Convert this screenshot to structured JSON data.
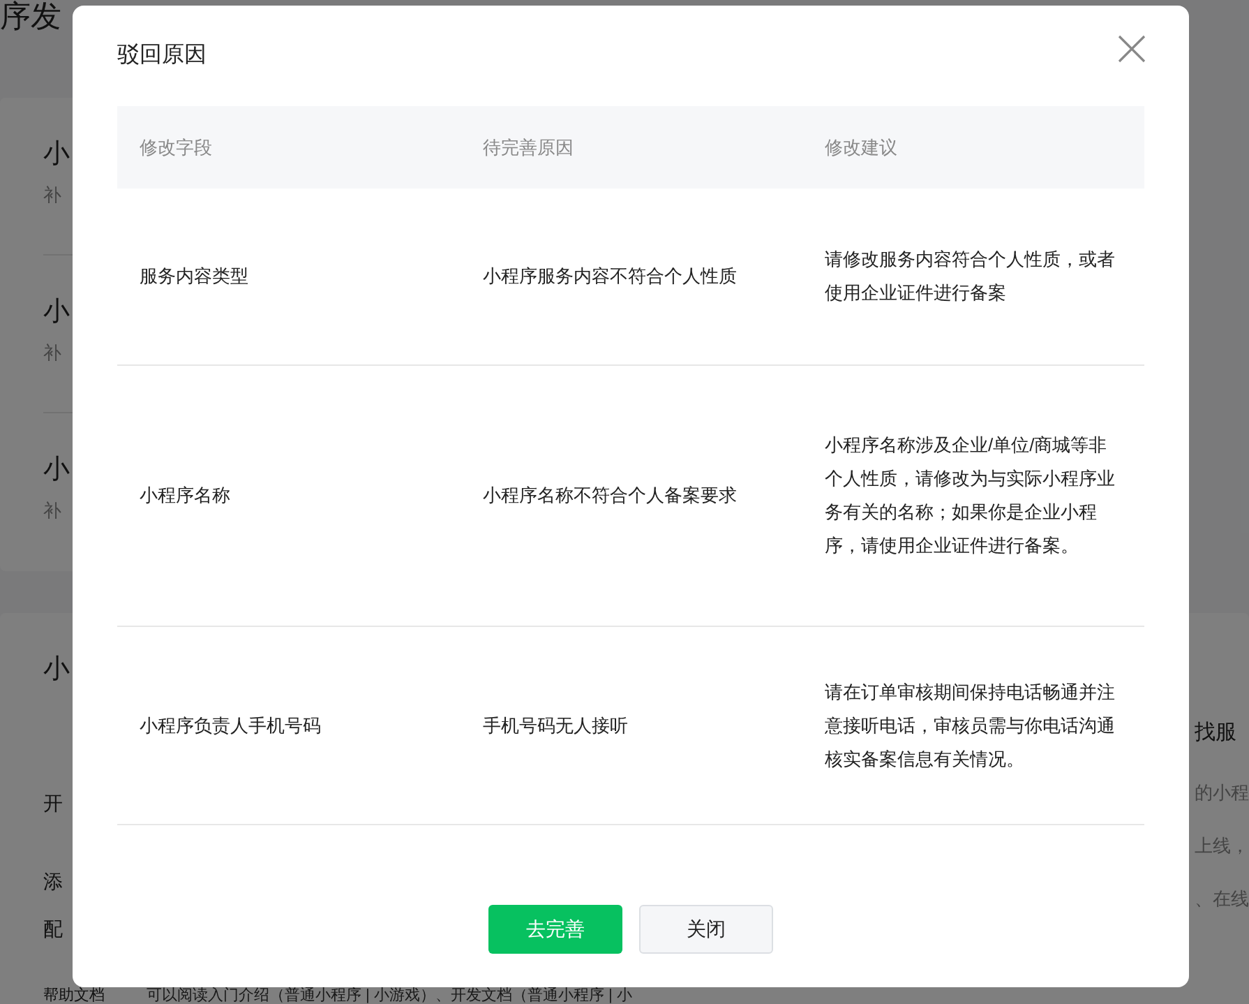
{
  "background": {
    "title": "序发",
    "sections": [
      {
        "heading": "小",
        "note": "补"
      },
      {
        "heading": "小",
        "note": "补"
      },
      {
        "heading": "小",
        "note": "补"
      }
    ],
    "panel": {
      "heading": "小",
      "labels": [
        "开",
        "添",
        "配"
      ],
      "help_label": "帮助文档",
      "help_text": "可以阅读入门介绍（普通小程序 | 小游戏）、开发文档（普通小程序 | 小"
    },
    "side": {
      "heading": "找服",
      "lines": [
        "的小程",
        "上线，",
        "、在线"
      ]
    }
  },
  "dialog": {
    "title": "驳回原因",
    "columns": [
      "修改字段",
      "待完善原因",
      "修改建议"
    ],
    "rows": [
      [
        "服务内容类型",
        "小程序服务内容不符合个人性质",
        "请修改服务内容符合个人性质，或者使用企业证件进行备案"
      ],
      [
        "小程序名称",
        "小程序名称不符合个人备案要求",
        "小程序名称涉及企业/单位/商城等非个人性质，请修改为与实际小程序业务有关的名称；如果你是企业小程序，请使用企业证件进行备案。"
      ],
      [
        "小程序负责人手机号码",
        "手机号码无人接听",
        "请在订单审核期间保持电话畅通并注意接听电话，审核员需与你电话沟通核实备案信息有关情况。"
      ]
    ],
    "buttons": [
      {
        "label": "去完善",
        "kind": "primary"
      },
      {
        "label": "关闭",
        "kind": "secondary"
      }
    ]
  }
}
